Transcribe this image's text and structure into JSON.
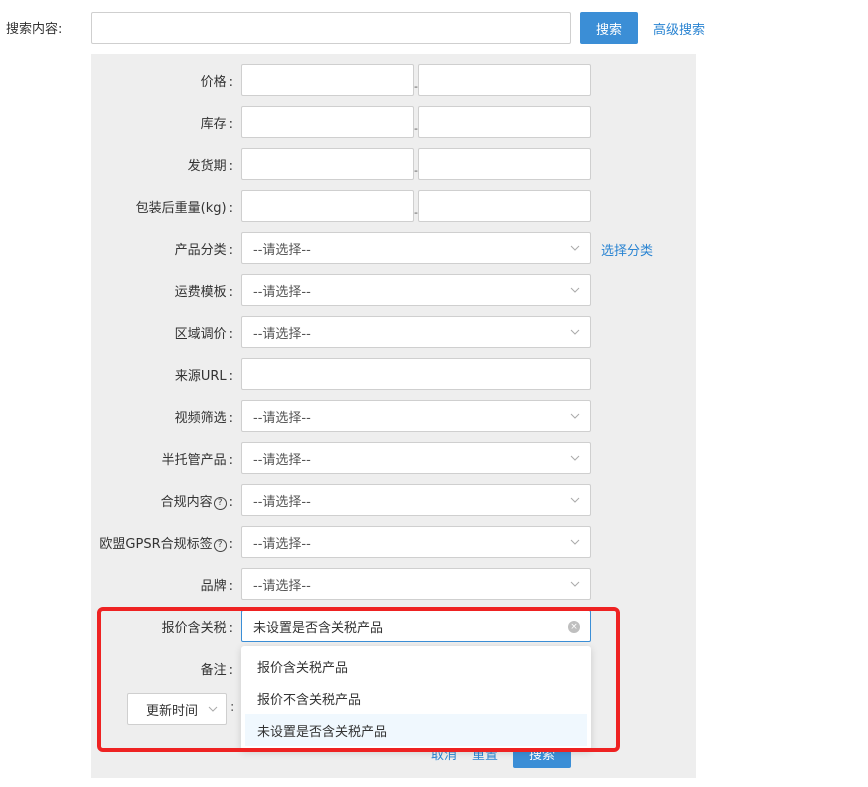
{
  "search": {
    "label": "搜索内容:",
    "button_label": "搜索",
    "advanced_link": "高级搜索"
  },
  "filters": {
    "price_label": "价格",
    "stock_label": "库存",
    "ship_label": "发货期",
    "weight_label": "包装后重量(kg)",
    "range_sep": "-",
    "category_label": "产品分类",
    "category_value": "--请选择--",
    "choose_category_link": "选择分类",
    "freight_label": "运费模板",
    "freight_value": "--请选择--",
    "region_label": "区域调价",
    "region_value": "--请选择--",
    "source_label": "来源URL",
    "video_label": "视频筛选",
    "video_value": "--请选择--",
    "semi_label": "半托管产品",
    "semi_value": "--请选择--",
    "compliance_label": "合规内容",
    "compliance_value": "--请选择--",
    "gpsr_label": "欧盟GPSR合规标签",
    "gpsr_value": "--请选择--",
    "brand_label": "品牌",
    "brand_value": "--请选择--",
    "tax_label": "报价含关税",
    "tax_value": "未设置是否含关税产品",
    "note_label": "备注",
    "colon": ":",
    "help_glyph": "?"
  },
  "tax_dropdown": {
    "options": [
      "报价含关税产品",
      "报价不含关税产品",
      "未设置是否含关税产品"
    ],
    "selected_index": 2
  },
  "sort": {
    "value": "更新时间"
  },
  "footer": {
    "cancel": "取消",
    "reset": "重置",
    "search": "搜索"
  },
  "colors": {
    "primary": "#3b8ed6",
    "link": "#2a84d2",
    "highlight": "#ee2222",
    "panel_bg": "#eeeeee"
  }
}
